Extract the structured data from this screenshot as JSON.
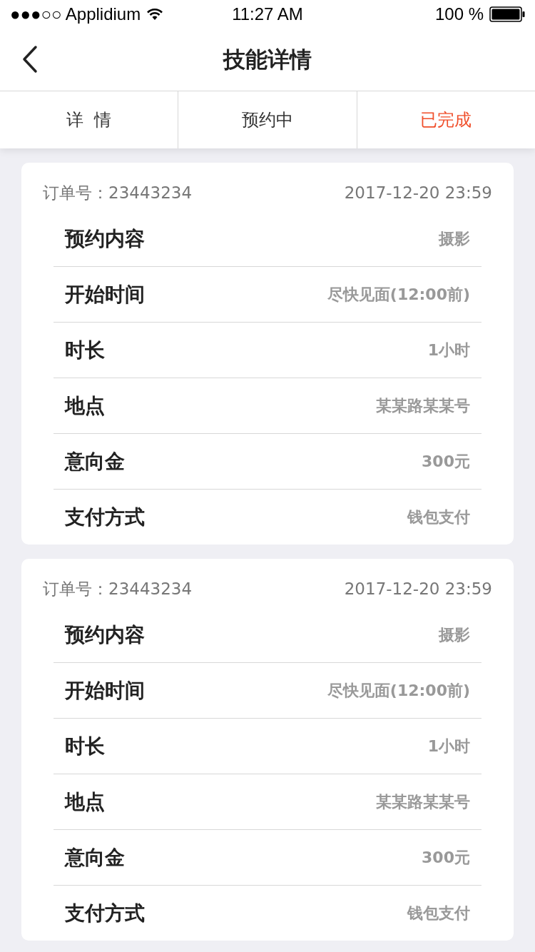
{
  "status_bar": {
    "carrier": "●●●○○ Applidium",
    "time": "11:27 AM",
    "battery": "100 %"
  },
  "nav": {
    "title": "技能详情"
  },
  "tabs": [
    {
      "label": "详  情",
      "selected": false
    },
    {
      "label": "预约中",
      "selected": false
    },
    {
      "label": "已完成",
      "selected": true
    }
  ],
  "orders": [
    {
      "order_label": "订单号：23443234",
      "datetime": "2017-12-20 23:59",
      "rows": [
        {
          "label": "预约内容",
          "value": "摄影"
        },
        {
          "label": "开始时间",
          "value": "尽快见面(12:00前)"
        },
        {
          "label": "时长",
          "value": "1小时"
        },
        {
          "label": "地点",
          "value": "某某路某某号"
        },
        {
          "label": "意向金",
          "value": "300元"
        },
        {
          "label": "支付方式",
          "value": "钱包支付"
        }
      ]
    },
    {
      "order_label": "订单号：23443234",
      "datetime": "2017-12-20 23:59",
      "rows": [
        {
          "label": "预约内容",
          "value": "摄影"
        },
        {
          "label": "开始时间",
          "value": "尽快见面(12:00前)"
        },
        {
          "label": "时长",
          "value": "1小时"
        },
        {
          "label": "地点",
          "value": "某某路某某号"
        },
        {
          "label": "意向金",
          "value": "300元"
        },
        {
          "label": "支付方式",
          "value": "钱包支付"
        }
      ]
    }
  ]
}
